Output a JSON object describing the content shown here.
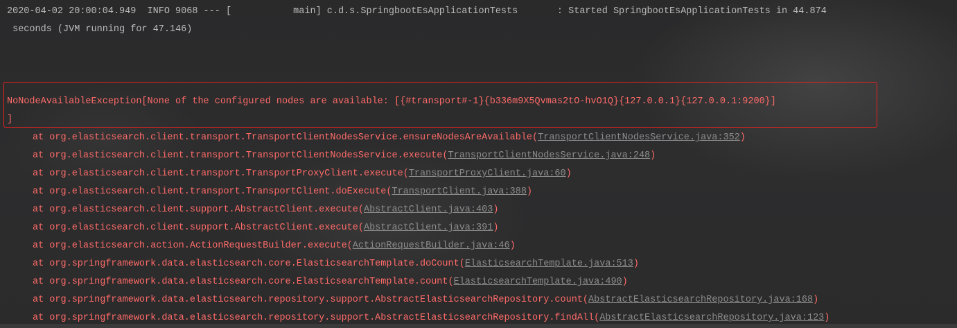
{
  "console": {
    "log_line_1": "2020-04-02 20:00:04.949  INFO 9068 --- [           main] c.d.s.SpringbootEsApplicationTests       : Started SpringbootEsApplicationTests in 44.874",
    "log_line_2": " seconds (JVM running for 47.146)",
    "exception_line_1": "NoNodeAvailableException[None of the configured nodes are available: [{#transport#-1}{b336m9X5Qvmas2tO-hvO1Q}{127.0.0.1}{127.0.0.1:9200}]",
    "exception_line_2": "]",
    "stack_trace": [
      {
        "method": "at org.elasticsearch.client.transport.TransportClientNodesService.ensureNodesAreAvailable(",
        "source": "TransportClientNodesService.java:352"
      },
      {
        "method": "at org.elasticsearch.client.transport.TransportClientNodesService.execute(",
        "source": "TransportClientNodesService.java:248"
      },
      {
        "method": "at org.elasticsearch.client.transport.TransportProxyClient.execute(",
        "source": "TransportProxyClient.java:60"
      },
      {
        "method": "at org.elasticsearch.client.transport.TransportClient.doExecute(",
        "source": "TransportClient.java:388"
      },
      {
        "method": "at org.elasticsearch.client.support.AbstractClient.execute(",
        "source": "AbstractClient.java:403"
      },
      {
        "method": "at org.elasticsearch.client.support.AbstractClient.execute(",
        "source": "AbstractClient.java:391"
      },
      {
        "method": "at org.elasticsearch.action.ActionRequestBuilder.execute(",
        "source": "ActionRequestBuilder.java:46"
      },
      {
        "method": "at org.springframework.data.elasticsearch.core.ElasticsearchTemplate.doCount(",
        "source": "ElasticsearchTemplate.java:513"
      },
      {
        "method": "at org.springframework.data.elasticsearch.core.ElasticsearchTemplate.count(",
        "source": "ElasticsearchTemplate.java:490"
      },
      {
        "method": "at org.springframework.data.elasticsearch.repository.support.AbstractElasticsearchRepository.count(",
        "source": "AbstractElasticsearchRepository.java:168"
      },
      {
        "method": "at org.springframework.data.elasticsearch.repository.support.AbstractElasticsearchRepository.findAll(",
        "source": "AbstractElasticsearchRepository.java:123"
      }
    ],
    "close_paren": ")"
  },
  "colors": {
    "error": "#ff6b68",
    "info": "#bbbbbb",
    "link": "#8c8c8c",
    "highlight_border": "#e8231f"
  }
}
